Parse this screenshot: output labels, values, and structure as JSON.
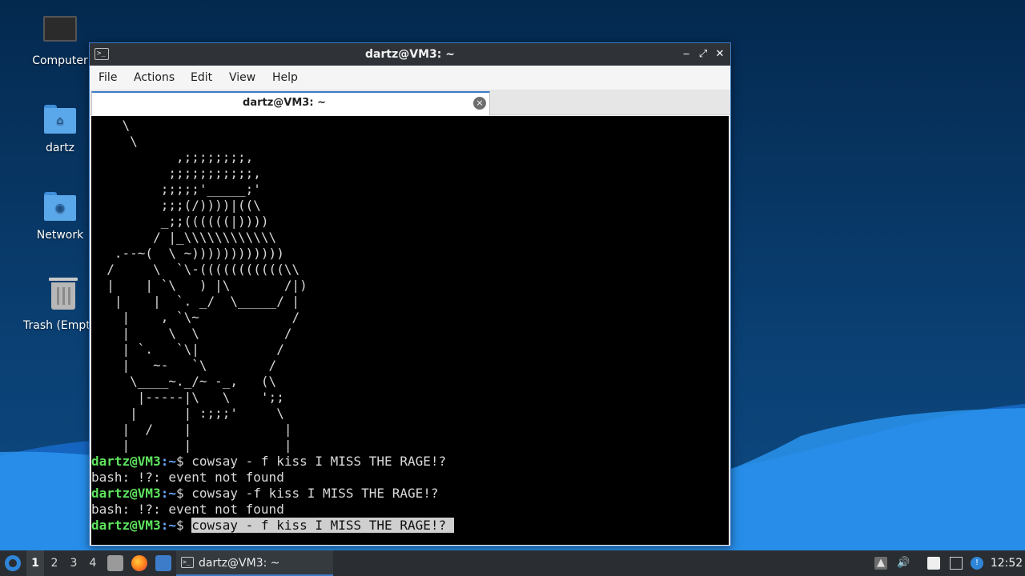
{
  "desktop": {
    "icons": [
      {
        "label": "Computer",
        "icon": "computer-icon"
      },
      {
        "label": "dartz",
        "icon": "home-folder-icon"
      },
      {
        "label": "Network",
        "icon": "network-folder-icon"
      },
      {
        "label": "Trash (Empty)",
        "icon": "trash-icon"
      }
    ]
  },
  "window": {
    "title": "dartz@VM3: ~",
    "controls": {
      "minimize": "‒",
      "maximize": "⤢",
      "close": "✕"
    },
    "menu": [
      "File",
      "Actions",
      "Edit",
      "View",
      "Help"
    ],
    "tab": {
      "title": "dartz@VM3: ~",
      "close": "×"
    }
  },
  "terminal": {
    "ascii_art": [
      "    \\",
      "     \\",
      "           ,;;;;;;;;,",
      "          ;;;;;;;;;;;,",
      "         ;;;;;'_____;'",
      "         ;;;(/))))|((\\",
      "         _;;((((((|))))",
      "        / |_\\\\\\\\\\\\\\\\\\\\\\\\",
      "   .--~(  \\ ~))))))))))))",
      "  /     \\  `\\-(((((((((((\\\\",
      "  |    | `\\   ) |\\       /|)",
      "   |    |  `. _/  \\_____/ |",
      "    |    , `\\~            /",
      "    |     \\  \\           /",
      "    | `.   `\\|          /",
      "    |   ~-   `\\        /",
      "     \\____~._/~ -_,   (\\",
      "      |-----|\\   \\    ';;",
      "     |      | :;;;'     \\",
      "    |  /    |            |",
      "    |       |            |"
    ],
    "lines": [
      {
        "user": "dartz@VM3",
        "path": ":~",
        "cmd": "$ cowsay - f kiss I MISS THE RAGE!?"
      },
      {
        "output": "bash: !?: event not found"
      },
      {
        "user": "dartz@VM3",
        "path": ":~",
        "cmd": "$ cowsay -f kiss I MISS THE RAGE!?"
      },
      {
        "output": "bash: !?: event not found"
      },
      {
        "user": "dartz@VM3",
        "path": ":~",
        "prompt": "$ ",
        "selected_cmd": "cowsay - f kiss I MISS THE RAGE!? "
      }
    ]
  },
  "taskbar": {
    "workspaces": [
      "1",
      "2",
      "3",
      "4"
    ],
    "active_workspace": "1",
    "quicklaunch": [
      "file-manager-icon",
      "firefox-icon",
      "desktop-icon"
    ],
    "task": {
      "label": "dartz@VM3: ~",
      "icon": "terminal-icon"
    },
    "tray": [
      "tray-up-icon",
      "volume-icon",
      "clipboard-icon",
      "network-icon",
      "update-icon"
    ],
    "clock": "12:52"
  },
  "colors": {
    "accent": "#3d7cc9",
    "prompt_user": "#5ee35e",
    "prompt_path": "#6aa8ff",
    "terminal_bg": "#000000"
  }
}
